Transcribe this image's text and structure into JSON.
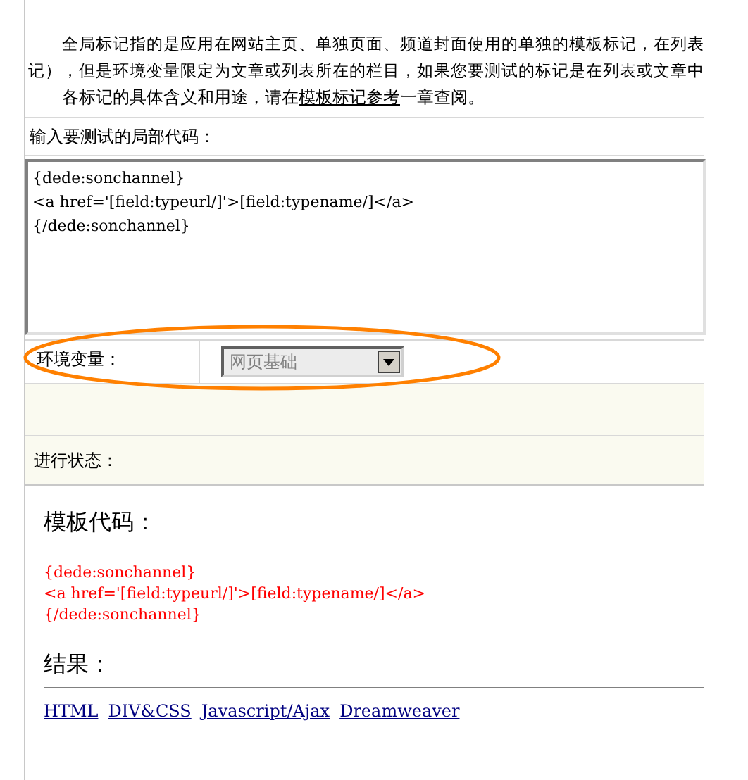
{
  "intro": {
    "lines": [
      "全局标记指的是应用在网站主页、单独页面、频道封面使用的单独的模板标记，在列表",
      "记），但是环境变量限定为文章或列表所在的栏目，如果您要测试的标记是在列表或文章中"
    ],
    "last_line": {
      "before": "各标记的具体含义和用途，请在",
      "link": "模板标记参考",
      "after": "一章查阅。"
    }
  },
  "code_input": {
    "label": "输入要测试的局部代码：",
    "value": "{dede:sonchannel}\n<a href='[field:typeurl/]'>[field:typename/]</a>\n{/dede:sonchannel}"
  },
  "environment": {
    "label": "环境变量：",
    "select_value": "网页基础",
    "highlighted": true
  },
  "status": {
    "label": "进行状态："
  },
  "result": {
    "template_heading": "模板代码：",
    "template_code": [
      "{dede:sonchannel}",
      "<a href='[field:typeurl/]'>[field:typename/]</a>",
      "{/dede:sonchannel}"
    ],
    "result_heading": "结果：",
    "links": [
      "HTML",
      "DIV&CSS",
      "Javascript/Ajax",
      "Dreamweaver"
    ]
  }
}
